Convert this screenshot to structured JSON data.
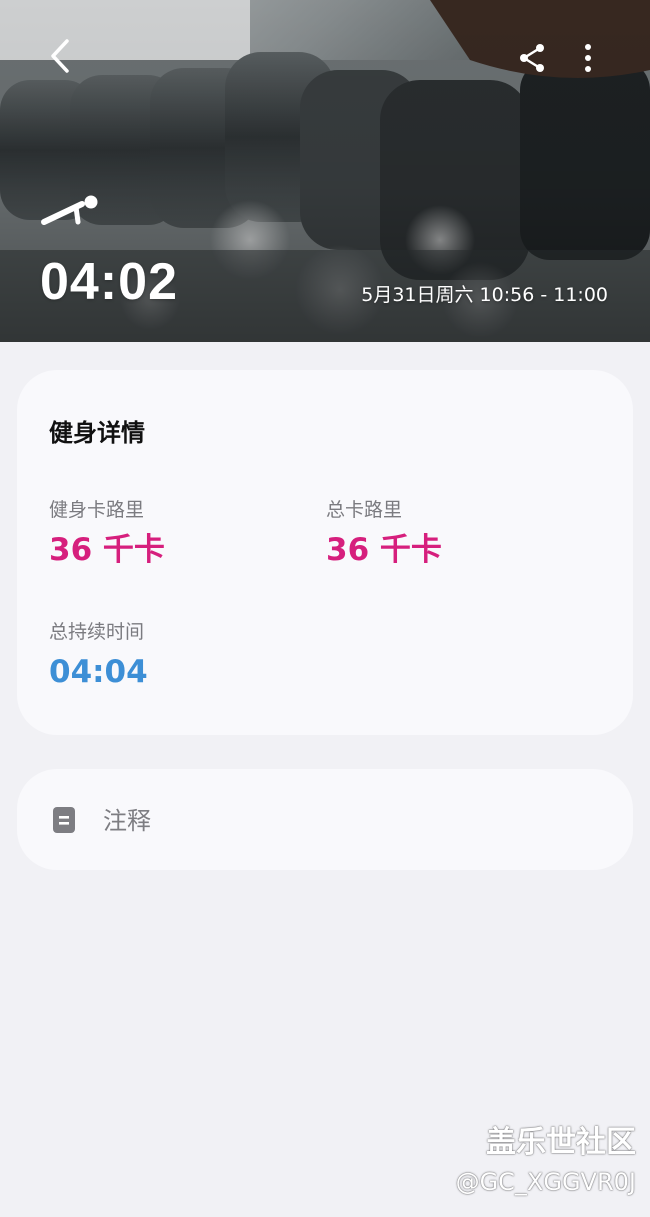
{
  "header": {
    "duration": "04:02",
    "date_range": "5月31日周六 10:56 - 11:00",
    "back_icon": "chevron-left-icon",
    "share_icon": "share-icon",
    "more_icon": "more-vertical-icon",
    "exercise_icon": "pushup-icon"
  },
  "details": {
    "title": "健身详情",
    "stats": [
      {
        "label": "健身卡路里",
        "value": "36 千卡",
        "color": "#d61f7d"
      },
      {
        "label": "总卡路里",
        "value": "36 千卡",
        "color": "#d61f7d"
      },
      {
        "label": "总持续时间",
        "value": "04:04",
        "color": "#3d8fd6"
      }
    ]
  },
  "notes": {
    "icon": "note-icon",
    "label": "注释"
  },
  "watermark": {
    "title": "盖乐世社区",
    "user": "@GC_XGGVR0J"
  },
  "colors": {
    "background": "#f1f1f5",
    "card": "#f9f9fc",
    "calorie_accent": "#d61f7d",
    "time_accent": "#3d8fd6"
  }
}
